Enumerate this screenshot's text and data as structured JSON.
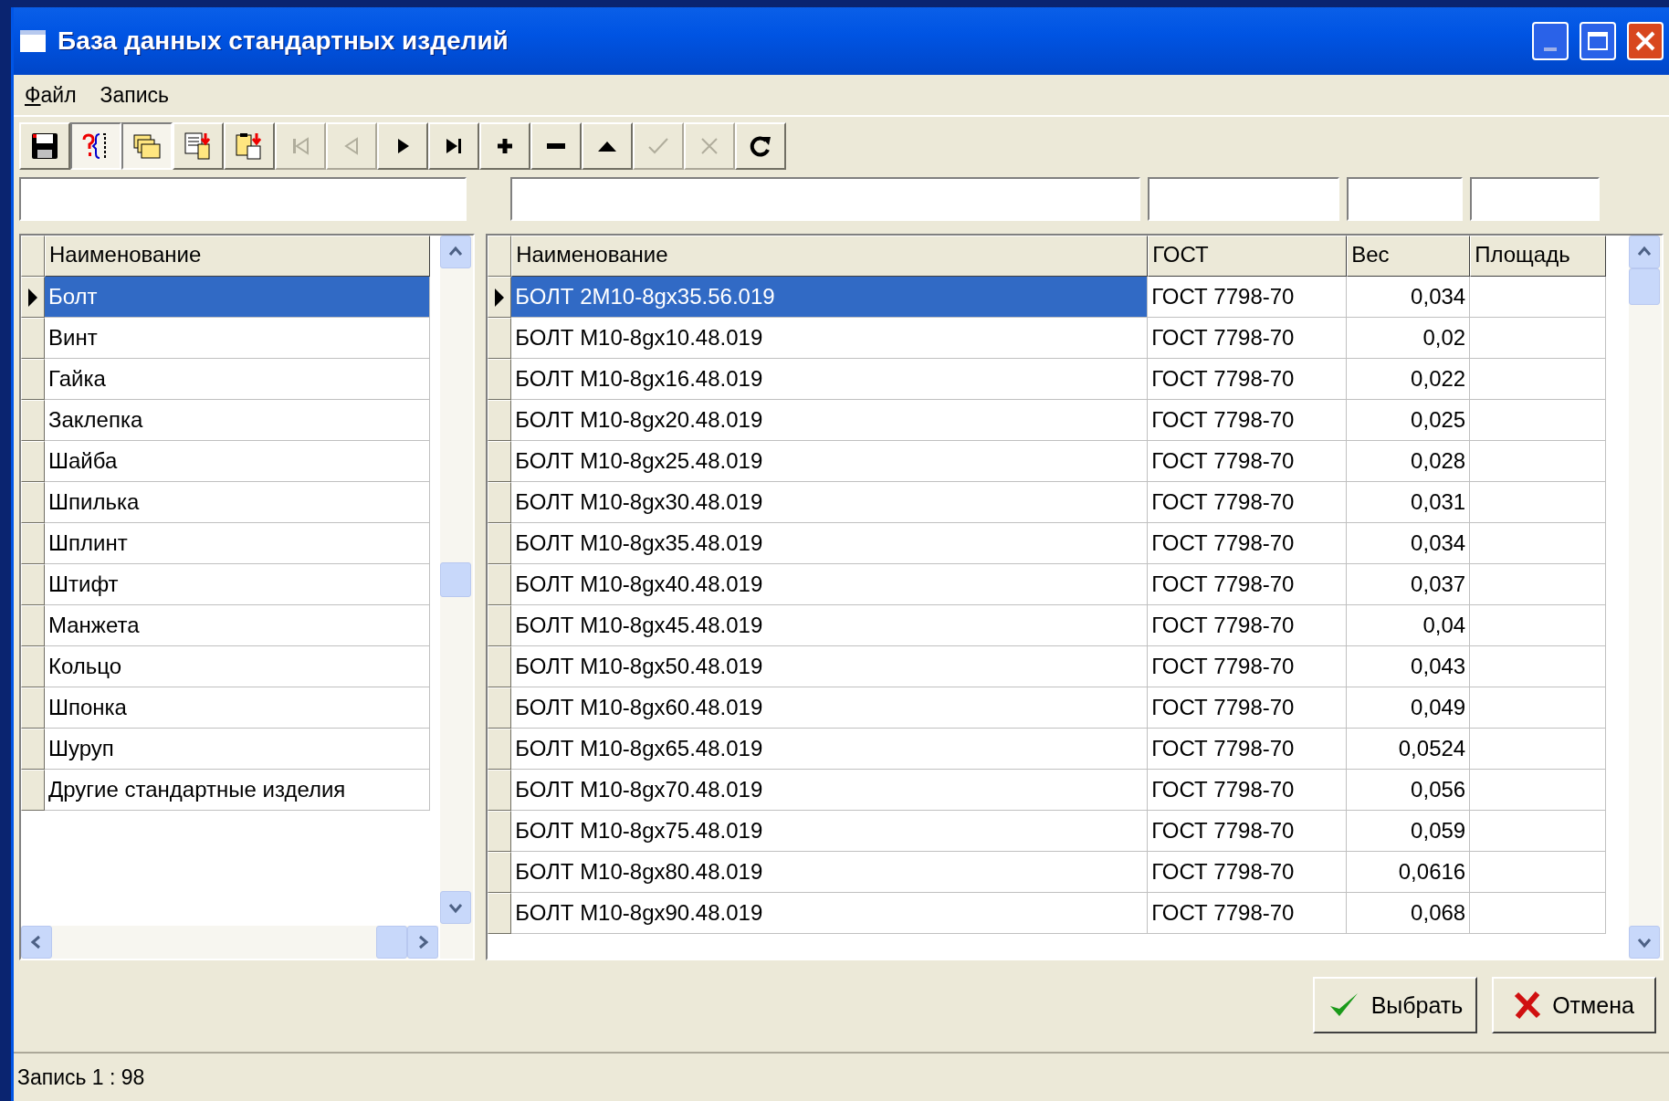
{
  "window": {
    "title": "База данных стандартных изделий"
  },
  "menu": [
    {
      "label": "Файл",
      "underlined_key": true
    },
    {
      "label": "Запись",
      "underlined_key": false
    }
  ],
  "toolbar": [
    {
      "kind": "save",
      "pressed": false,
      "disabled": false
    },
    {
      "kind": "query",
      "pressed": true,
      "disabled": false
    },
    {
      "kind": "folders",
      "pressed": true,
      "disabled": false
    },
    {
      "kind": "copy",
      "pressed": false,
      "disabled": false
    },
    {
      "kind": "paste",
      "pressed": false,
      "disabled": false
    },
    {
      "kind": "first",
      "pressed": false,
      "disabled": true
    },
    {
      "kind": "prior",
      "pressed": false,
      "disabled": true
    },
    {
      "kind": "next",
      "pressed": false,
      "disabled": false
    },
    {
      "kind": "last",
      "pressed": false,
      "disabled": false
    },
    {
      "kind": "insert",
      "pressed": false,
      "disabled": false
    },
    {
      "kind": "delete",
      "pressed": false,
      "disabled": false
    },
    {
      "kind": "edit",
      "pressed": false,
      "disabled": false
    },
    {
      "kind": "post",
      "pressed": false,
      "disabled": true
    },
    {
      "kind": "cancel",
      "pressed": false,
      "disabled": true
    },
    {
      "kind": "refresh",
      "pressed": false,
      "disabled": false
    }
  ],
  "categories": {
    "column": "Наименование",
    "rows": [
      {
        "name": "Болт",
        "selected": true
      },
      {
        "name": "Винт",
        "selected": false
      },
      {
        "name": "Гайка",
        "selected": false
      },
      {
        "name": "Заклепка",
        "selected": false
      },
      {
        "name": "Шайба",
        "selected": false
      },
      {
        "name": "Шпилька",
        "selected": false
      },
      {
        "name": "Шплинт",
        "selected": false
      },
      {
        "name": "Штифт",
        "selected": false
      },
      {
        "name": "Манжета",
        "selected": false
      },
      {
        "name": "Кольцо",
        "selected": false
      },
      {
        "name": "Шпонка",
        "selected": false
      },
      {
        "name": "Шуруп",
        "selected": false
      },
      {
        "name": "Другие стандартные изделия",
        "selected": false
      }
    ]
  },
  "items": {
    "columns": [
      "Наименование",
      "ГОСТ",
      "Вес",
      "Площадь"
    ],
    "rows": [
      {
        "name": "БОЛТ 2М10-8gx35.56.019",
        "gost": "ГОСТ 7798-70",
        "weight": "0,034",
        "selected": true
      },
      {
        "name": "БОЛТ М10-8gx10.48.019",
        "gost": "ГОСТ 7798-70",
        "weight": "0,02",
        "selected": false
      },
      {
        "name": "БОЛТ М10-8gx16.48.019",
        "gost": "ГОСТ 7798-70",
        "weight": "0,022",
        "selected": false
      },
      {
        "name": "БОЛТ М10-8gx20.48.019",
        "gost": "ГОСТ 7798-70",
        "weight": "0,025",
        "selected": false
      },
      {
        "name": "БОЛТ М10-8gx25.48.019",
        "gost": "ГОСТ 7798-70",
        "weight": "0,028",
        "selected": false
      },
      {
        "name": "БОЛТ М10-8gx30.48.019",
        "gost": "ГОСТ 7798-70",
        "weight": "0,031",
        "selected": false
      },
      {
        "name": "БОЛТ М10-8gx35.48.019",
        "gost": "ГОСТ 7798-70",
        "weight": "0,034",
        "selected": false
      },
      {
        "name": "БОЛТ М10-8gx40.48.019",
        "gost": "ГОСТ 7798-70",
        "weight": "0,037",
        "selected": false
      },
      {
        "name": "БОЛТ М10-8gx45.48.019",
        "gost": "ГОСТ 7798-70",
        "weight": "0,04",
        "selected": false
      },
      {
        "name": "БОЛТ М10-8gx50.48.019",
        "gost": "ГОСТ 7798-70",
        "weight": "0,043",
        "selected": false
      },
      {
        "name": "БОЛТ М10-8gx60.48.019",
        "gost": "ГОСТ 7798-70",
        "weight": "0,049",
        "selected": false
      },
      {
        "name": "БОЛТ М10-8gx65.48.019",
        "gost": "ГОСТ 7798-70",
        "weight": "0,0524",
        "selected": false
      },
      {
        "name": "БОЛТ М10-8gx70.48.019",
        "gost": "ГОСТ 7798-70",
        "weight": "0,056",
        "selected": false
      },
      {
        "name": "БОЛТ М10-8gx75.48.019",
        "gost": "ГОСТ 7798-70",
        "weight": "0,059",
        "selected": false
      },
      {
        "name": "БОЛТ М10-8gx80.48.019",
        "gost": "ГОСТ 7798-70",
        "weight": "0,0616",
        "selected": false
      },
      {
        "name": "БОЛТ М10-8gx90.48.019",
        "gost": "ГОСТ 7798-70",
        "weight": "0,068",
        "selected": false
      }
    ]
  },
  "buttons": [
    {
      "kind": "ok",
      "label": "Выбрать"
    },
    {
      "kind": "cancel",
      "label": "Отмена"
    }
  ],
  "status_bar": "Запись 1 : 98"
}
